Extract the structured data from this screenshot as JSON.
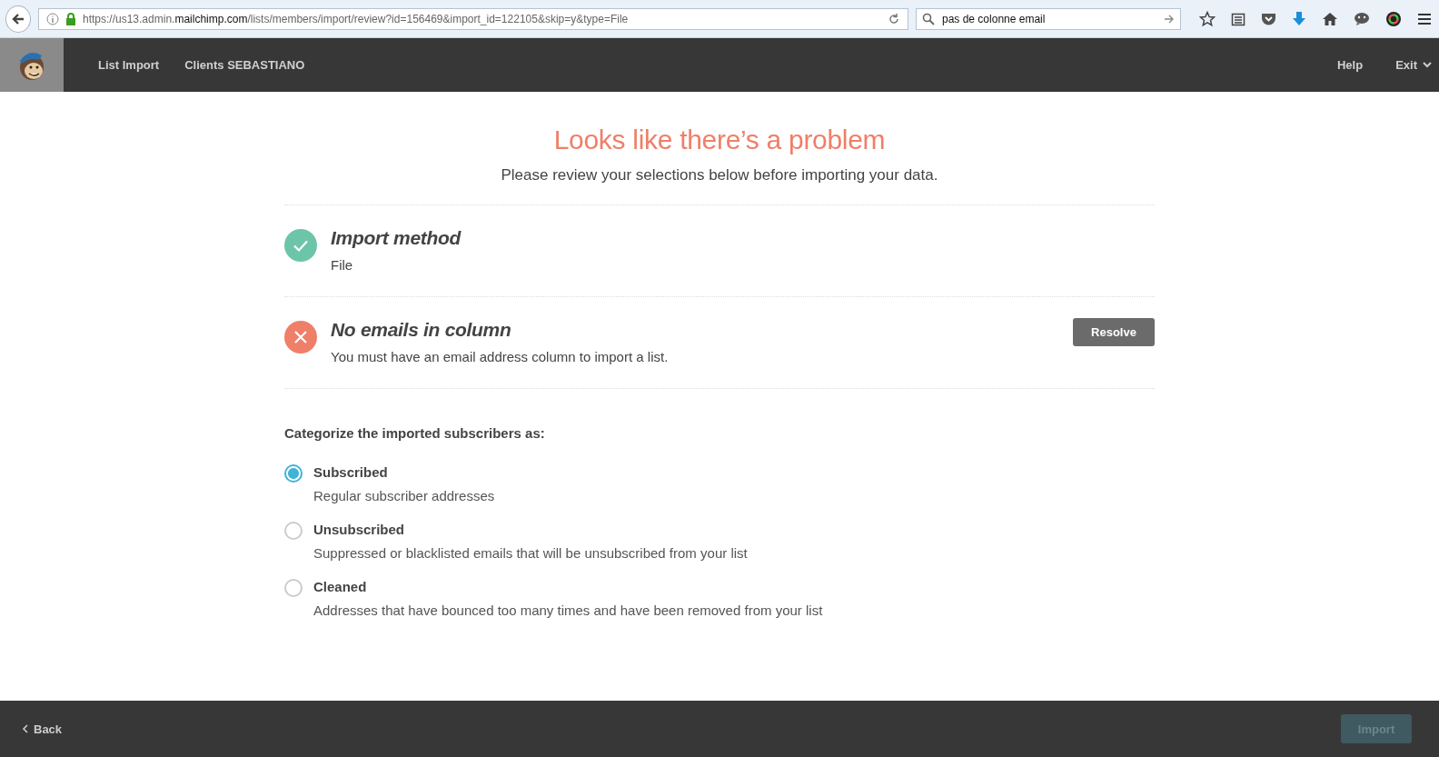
{
  "browser": {
    "url": "https://us13.admin.**mailchimp.com**/lists/members/import/review?id=156469&import_id=122105&skip=y&type=File",
    "search": "pas de colonne email"
  },
  "header": {
    "nav": [
      "List Import",
      "Clients SEBASTIANO"
    ],
    "help": "Help",
    "exit": "Exit"
  },
  "title": "Looks like there’s a problem",
  "subtitle": "Please review your selections below before importing your data.",
  "review_items": [
    {
      "kind": "ok",
      "heading": "Import method",
      "detail": "File"
    },
    {
      "kind": "error",
      "heading": "No emails in column",
      "detail": "You must have an email address column to import a list.",
      "button": "Resolve"
    }
  ],
  "categorize": {
    "label": "Categorize the imported subscribers as:",
    "options": [
      {
        "label": "Subscribed",
        "description": "Regular subscriber addresses",
        "selected": true
      },
      {
        "label": "Unsubscribed",
        "description": "Suppressed or blacklisted emails that will be unsubscribed from your list",
        "selected": false
      },
      {
        "label": "Cleaned",
        "description": "Addresses that have bounced too many times and have been removed from your list",
        "selected": false
      }
    ]
  },
  "footer": {
    "back": "Back",
    "import": {
      "label": "Import",
      "disabled": true
    }
  }
}
